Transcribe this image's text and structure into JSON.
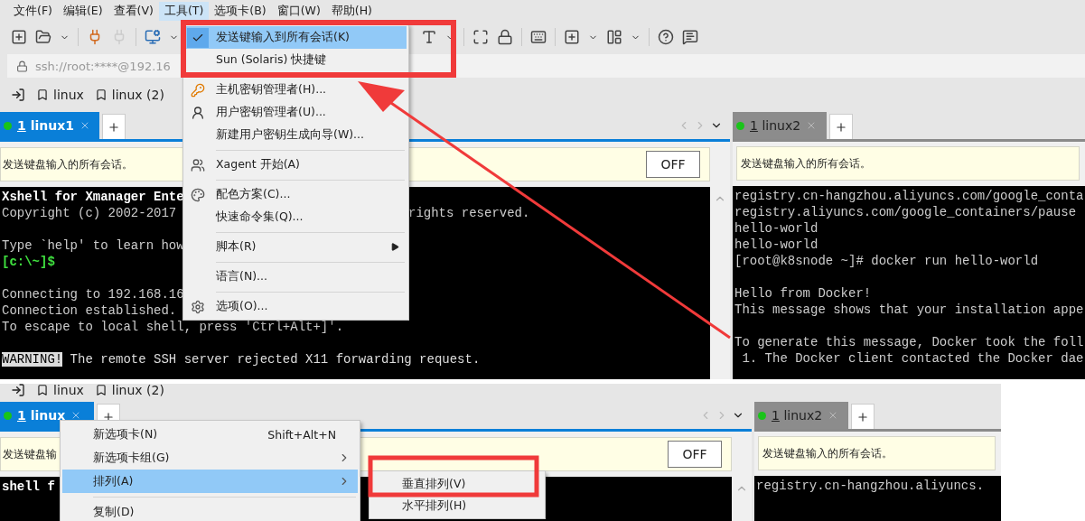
{
  "top": {
    "menu_bar": [
      {
        "label": "文件(F)",
        "selected": false
      },
      {
        "label": "编辑(E)",
        "selected": false
      },
      {
        "label": "查看(V)",
        "selected": false
      },
      {
        "label": "工具(T)",
        "selected": true
      },
      {
        "label": "选项卡(B)",
        "selected": false
      },
      {
        "label": "窗口(W)",
        "selected": false
      },
      {
        "label": "帮助(H)",
        "selected": false
      }
    ],
    "address": "ssh://root:****@192.16",
    "links": [
      "linux",
      "linux (2)"
    ],
    "left_pane": {
      "tabs": [
        {
          "number": "1",
          "label": "linux1",
          "selected": true
        }
      ],
      "notice": "发送键盘输入的所有会话。",
      "toggle": "OFF",
      "terminal": [
        {
          "kind": "bold",
          "text": "Xshell for Xmanager Ente"
        },
        {
          "kind": "plain",
          "text": "Copyright (c) 2002-2017 ",
          "tail": "rights reserved."
        },
        {
          "kind": "blank"
        },
        {
          "kind": "plain",
          "text": "Type `help' to learn how"
        },
        {
          "kind": "prompt",
          "text": "[c:\\~]$"
        },
        {
          "kind": "blank"
        },
        {
          "kind": "plain",
          "text": "Connecting to 192.168.16"
        },
        {
          "kind": "plain",
          "text": "Connection established."
        },
        {
          "kind": "plain",
          "text": "To escape to local shell, press 'Ctrl+Alt+]'."
        },
        {
          "kind": "blank"
        },
        {
          "kind": "warning",
          "tag": "WARNING!",
          "text": " The remote SSH server rejected X11 forwarding request."
        }
      ]
    },
    "right_pane": {
      "tabs": [
        {
          "number": "1",
          "label": "linux2",
          "selected": false
        }
      ],
      "notice": "发送键盘输入的所有会话。",
      "terminal": [
        {
          "kind": "plain",
          "text": "registry.cn-hangzhou.aliyuncs.com/google_conta"
        },
        {
          "kind": "plain",
          "text": "registry.aliyuncs.com/google_containers/pause"
        },
        {
          "kind": "plain",
          "text": "hello-world"
        },
        {
          "kind": "plain",
          "text": "hello-world"
        },
        {
          "kind": "plain",
          "text": "[root@k8snode ~]# docker run hello-world"
        },
        {
          "kind": "blank"
        },
        {
          "kind": "plain",
          "text": "Hello from Docker!"
        },
        {
          "kind": "plain",
          "text": "This message shows that your installation appe"
        },
        {
          "kind": "blank"
        },
        {
          "kind": "plain",
          "text": "To generate this message, Docker took the foll"
        },
        {
          "kind": "plain",
          "text": " 1. The Docker client contacted the Docker dae"
        }
      ]
    },
    "tools_menu": [
      {
        "kind": "item",
        "label": "发送键输入到所有会话(K)",
        "checked": true,
        "selected": true,
        "submenu": false
      },
      {
        "kind": "item",
        "label": "Sun (Solaris) 快捷键",
        "checked": false,
        "selected": false,
        "submenu": false
      },
      {
        "kind": "separator"
      },
      {
        "kind": "item",
        "label": "主机密钥管理者(H)...",
        "checked": false,
        "selected": false,
        "submenu": false
      },
      {
        "kind": "item",
        "label": "用户密钥管理者(U)...",
        "checked": false,
        "selected": false,
        "submenu": false
      },
      {
        "kind": "item",
        "label": "新建用户密钥生成向导(W)...",
        "checked": false,
        "selected": false,
        "submenu": false
      },
      {
        "kind": "separator"
      },
      {
        "kind": "item",
        "label": "Xagent 开始(A)",
        "checked": false,
        "selected": false,
        "submenu": false
      },
      {
        "kind": "separator"
      },
      {
        "kind": "item",
        "label": "配色方案(C)...",
        "checked": false,
        "selected": false,
        "submenu": false
      },
      {
        "kind": "item",
        "label": "快速命令集(Q)...",
        "checked": false,
        "selected": false,
        "submenu": false
      },
      {
        "kind": "separator"
      },
      {
        "kind": "item",
        "label": "脚本(R)",
        "checked": false,
        "selected": false,
        "submenu": true
      },
      {
        "kind": "separator"
      },
      {
        "kind": "item",
        "label": "语言(N)...",
        "checked": false,
        "selected": false,
        "submenu": false
      },
      {
        "kind": "separator"
      },
      {
        "kind": "item",
        "label": "选项(O)...",
        "checked": false,
        "selected": false,
        "submenu": false
      }
    ]
  },
  "bottom": {
    "links": [
      "linux",
      "linux (2)"
    ],
    "left_pane": {
      "tabs": [
        {
          "number": "1",
          "label": "linux",
          "selected": true
        }
      ],
      "notice": "发送键盘输",
      "toggle": "OFF",
      "terminal": [
        {
          "kind": "bold",
          "text": "shell f"
        }
      ]
    },
    "right_pane": {
      "tabs": [
        {
          "number": "1",
          "label": "linux2",
          "selected": false
        }
      ],
      "notice": "发送键盘输入的所有会话。",
      "terminal": [
        {
          "kind": "plain",
          "text": "registry.cn-hangzhou.aliyuncs."
        }
      ]
    },
    "context_menu": [
      {
        "kind": "item",
        "label": "新选项卡(N)",
        "shortcut": "Shift+Alt+N",
        "selected": false,
        "submenu": false
      },
      {
        "kind": "item",
        "label": "新选项卡组(G)",
        "selected": false,
        "submenu": true
      },
      {
        "kind": "item",
        "label": "排列(A)",
        "selected": true,
        "submenu": true
      },
      {
        "kind": "separator"
      },
      {
        "kind": "item",
        "label": "复制(D)",
        "selected": false,
        "submenu": false
      }
    ],
    "submenu": [
      {
        "kind": "item",
        "label": "垂直排列(V)",
        "selected": false,
        "submenu": false
      },
      {
        "kind": "item",
        "label": "水平排列(H)",
        "selected": false,
        "submenu": false
      }
    ]
  }
}
